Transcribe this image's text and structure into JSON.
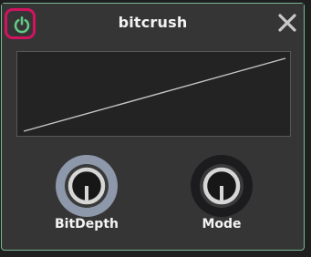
{
  "device": {
    "title": "bitcrush",
    "power_icon": "power-icon",
    "close_icon": "close-icon",
    "colors": {
      "border": "#7ab894",
      "power": "#62c986",
      "highlight_ring": "#d0145f"
    }
  },
  "graph": {
    "line_points": [
      [
        0.0,
        0.0
      ],
      [
        1.0,
        1.0
      ]
    ]
  },
  "knobs": [
    {
      "label": "BitDepth",
      "ring_color": "#8e98ab",
      "level": 1.0
    },
    {
      "label": "Mode",
      "ring_color": "#1c1c1f",
      "level": 1.0
    }
  ]
}
